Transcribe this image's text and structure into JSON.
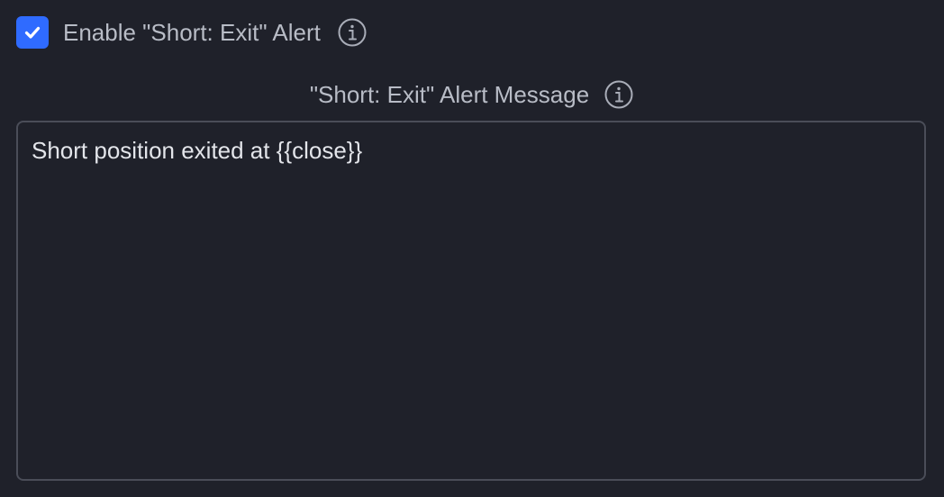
{
  "enable_alert": {
    "checked": true,
    "label": "Enable \"Short: Exit\" Alert",
    "info_icon": "info-icon"
  },
  "alert_message": {
    "label": "\"Short: Exit\" Alert Message",
    "info_icon": "info-icon",
    "value": "Short position exited at {{close}}"
  },
  "colors": {
    "background": "#1f212a",
    "accent": "#2f6bff",
    "label_text": "#b8bcc6",
    "input_text": "#e3e5ea",
    "input_border": "#4a4d58"
  }
}
